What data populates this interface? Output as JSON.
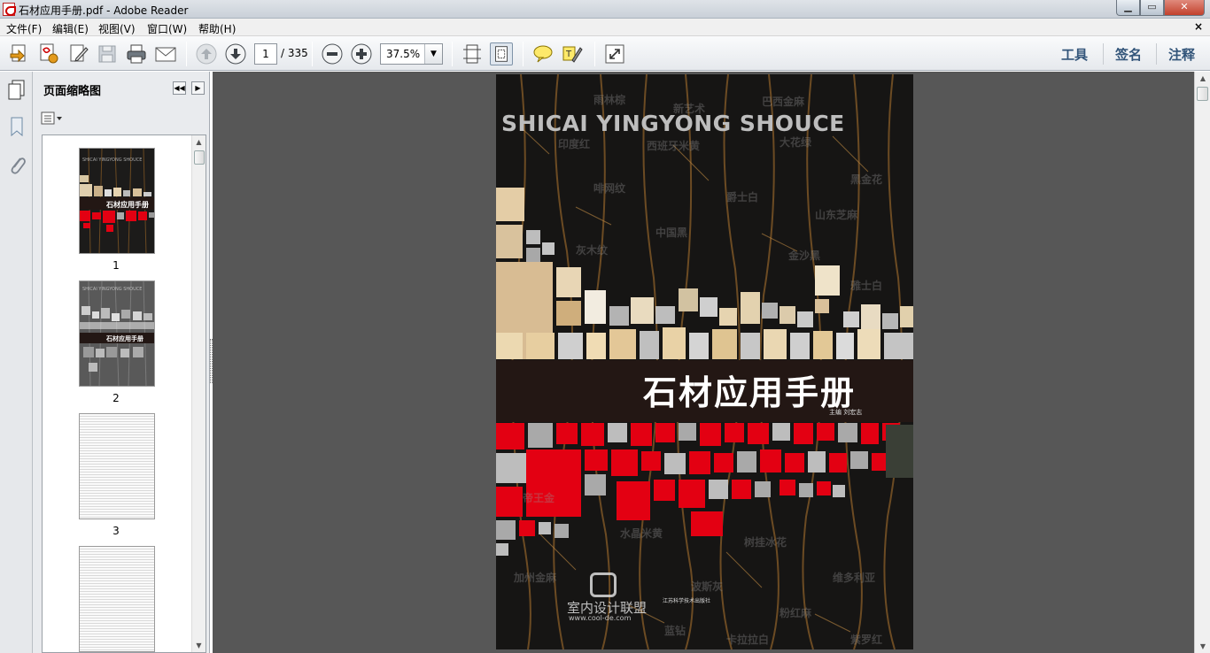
{
  "window": {
    "title": "石材应用手册.pdf - Adobe Reader",
    "min_label": "▁",
    "max_label": "▭",
    "close_label": "✕"
  },
  "menu": {
    "items": [
      "文件(F)",
      "编辑(E)",
      "视图(V)",
      "窗口(W)",
      "帮助(H)"
    ],
    "doc_close": "×"
  },
  "toolbar": {
    "page_current": "1",
    "page_total": "/ 335",
    "zoom": "37.5%",
    "right_links": [
      "工具",
      "签名",
      "注释"
    ]
  },
  "thumbnail_panel": {
    "title": "页面缩略图",
    "pages": [
      "1",
      "2",
      "3"
    ]
  },
  "cover": {
    "pinyin_title": "SHICAI YINGYONG SHOUCE",
    "title": "石材应用手册",
    "editor": "主编   刘宏志",
    "watermark_text": "室内设计联盟",
    "watermark_url": "www.cool-de.com",
    "publisher": "江苏科学技术出版社",
    "bg_words": [
      "雨林棕",
      "新艺术",
      "巴西金麻",
      "印度红",
      "西班牙米黄",
      "大花绿",
      "黑金花",
      "啡网纹",
      "爵士白",
      "山东芝麻",
      "中国黑",
      "灰木纹",
      "金沙黑",
      "雅士白",
      "帝王金",
      "水晶米黄",
      "树挂冰花",
      "维多利亚",
      "波斯灰",
      "加州金麻",
      "粉红麻",
      "蓝钻",
      "紫罗红",
      "卡拉拉白"
    ],
    "colors": {
      "red": "#e30012",
      "band": "#231714",
      "marble": "#161514"
    }
  }
}
